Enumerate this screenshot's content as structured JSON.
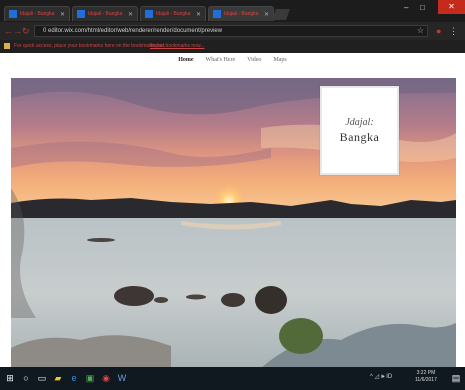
{
  "browser": {
    "tabs": [
      {
        "title": "Idajali - Bangka"
      },
      {
        "title": "Idajali - Bangka"
      },
      {
        "title": "Idajali - Bangka"
      },
      {
        "title": "Idajali - Bangka"
      }
    ],
    "address_url": "0 editor.wix.com/html/editor/web/renderer/render/document/preview",
    "bookmarks": [
      "For quick access, place your bookmarks here on the bookmarks bar.",
      "Import bookmarks now..."
    ],
    "window_controls": {
      "minimize": "–",
      "maximize": "□",
      "close": "✕"
    }
  },
  "site": {
    "nav": [
      "Home",
      "What's Here",
      "Video",
      "Maps"
    ],
    "active_nav": "Home",
    "brand": {
      "prefix": "Jdajal:",
      "name": "Bangka"
    }
  },
  "taskbar": {
    "tray_text": "^ ◿ 🕪 ID",
    "time": "3:22 PM",
    "date": "11/6/2017"
  },
  "colors": {
    "chrome_dark": "#1c1c1c",
    "close_red": "#c42b1c",
    "taskbar": "#101820"
  }
}
